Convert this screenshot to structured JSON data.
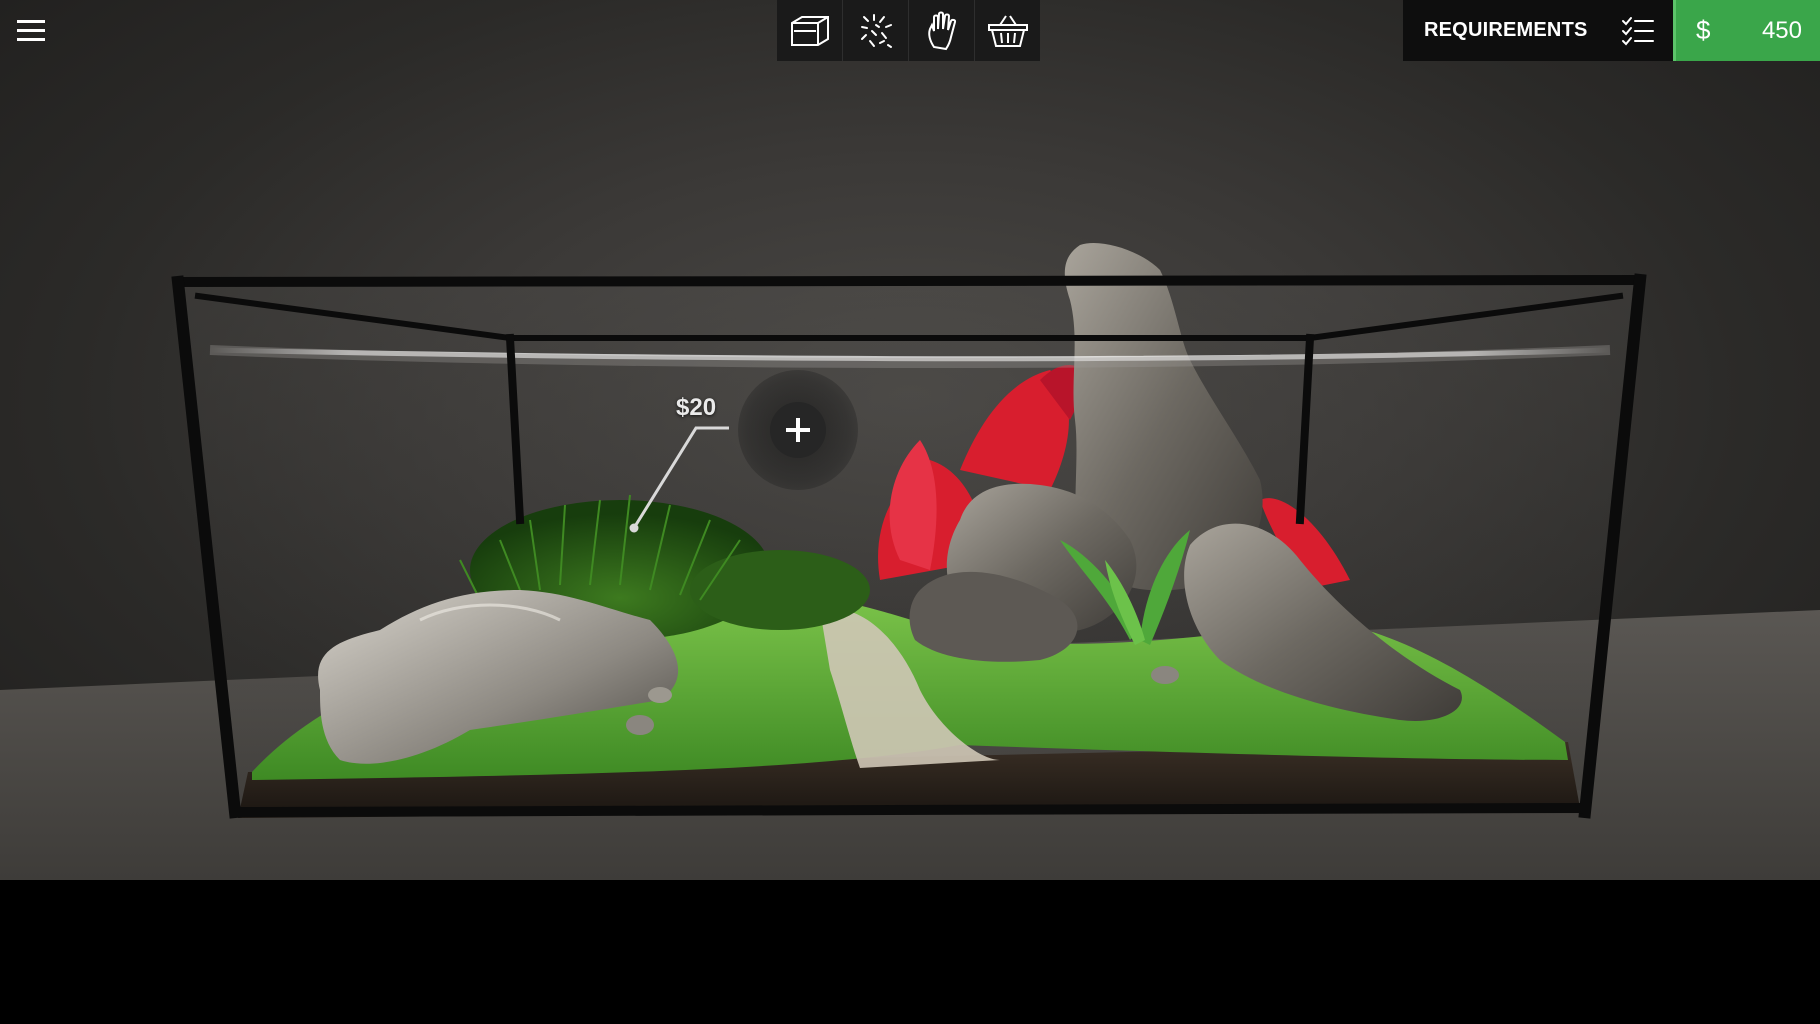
{
  "top_bar": {
    "menu_icon": "hamburger-menu-icon",
    "tools": [
      {
        "name": "tank-icon"
      },
      {
        "name": "substrate-icon"
      },
      {
        "name": "hand-icon"
      },
      {
        "name": "basket-icon"
      }
    ],
    "requirements_label": "REQUIREMENTS",
    "checklist_icon": "checklist-icon",
    "currency_symbol": "$",
    "money": "450"
  },
  "scene": {
    "price_tag": "$20",
    "add_icon": "plus-icon"
  },
  "colors": {
    "money_green": "#3aa64a",
    "panel_dark": "#0e0e0e",
    "toolbar_dark": "#1a1a1a",
    "plant_red": "#d81e2e",
    "moss_green": "#5fb63a"
  }
}
